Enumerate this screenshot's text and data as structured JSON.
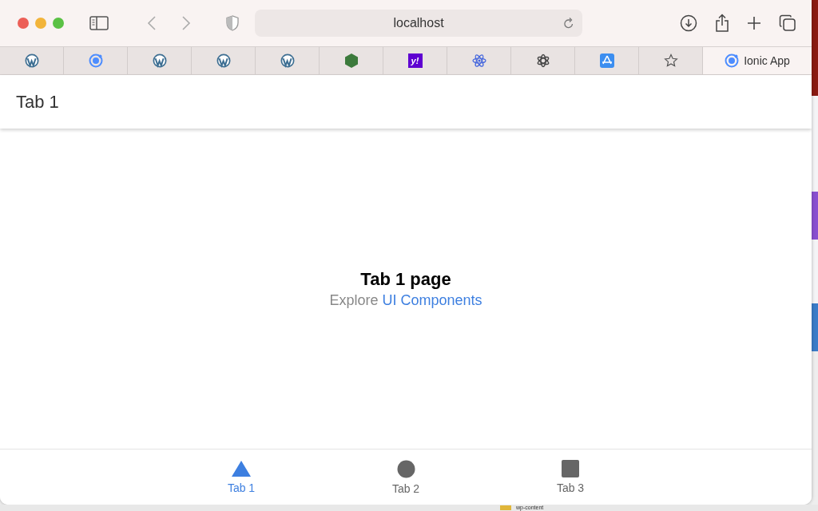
{
  "browser": {
    "address": "localhost"
  },
  "tabs": [
    {
      "kind": "wordpress",
      "selected": false
    },
    {
      "kind": "ionic",
      "selected": false
    },
    {
      "kind": "wordpress",
      "selected": false
    },
    {
      "kind": "wordpress",
      "selected": false
    },
    {
      "kind": "wordpress",
      "selected": false
    },
    {
      "kind": "hexagon",
      "selected": false
    },
    {
      "kind": "yahoo",
      "glyph": "y!",
      "selected": false
    },
    {
      "kind": "react",
      "selected": false
    },
    {
      "kind": "atom",
      "selected": false
    },
    {
      "kind": "appstore",
      "selected": false
    },
    {
      "kind": "star",
      "selected": false
    },
    {
      "kind": "ionic",
      "label": "Ionic App",
      "selected": true
    }
  ],
  "app": {
    "header_title": "Tab 1",
    "page_title": "Tab 1 page",
    "page_text": "Explore",
    "page_link": "UI Components",
    "tab_bar": [
      {
        "kind": "triangle",
        "label": "Tab 1",
        "selected": true
      },
      {
        "kind": "circle",
        "label": "Tab 2",
        "selected": false
      },
      {
        "kind": "square",
        "label": "Tab 3",
        "selected": false
      }
    ]
  },
  "background": {
    "folder_label": "wp-content"
  }
}
